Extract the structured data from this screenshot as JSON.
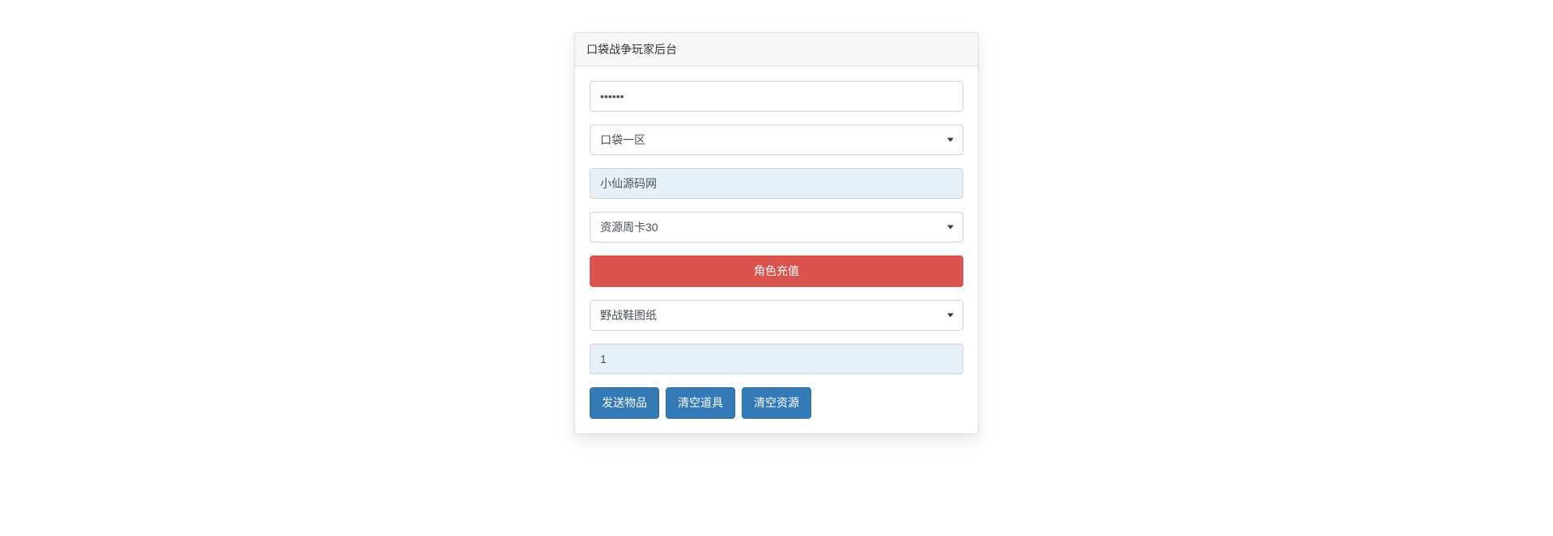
{
  "card": {
    "title": "口袋战争玩家后台"
  },
  "form": {
    "password_value": "••••••",
    "server_select": {
      "selected": "口袋一区"
    },
    "player_name_value": "小仙源码网",
    "recharge_select": {
      "selected": "资源周卡30"
    },
    "recharge_button": "角色充值",
    "item_select": {
      "selected": "野战鞋图纸"
    },
    "quantity_value": "1",
    "buttons": {
      "send_item": "发送物品",
      "clear_items": "清空道具",
      "clear_resources": "清空资源"
    }
  }
}
